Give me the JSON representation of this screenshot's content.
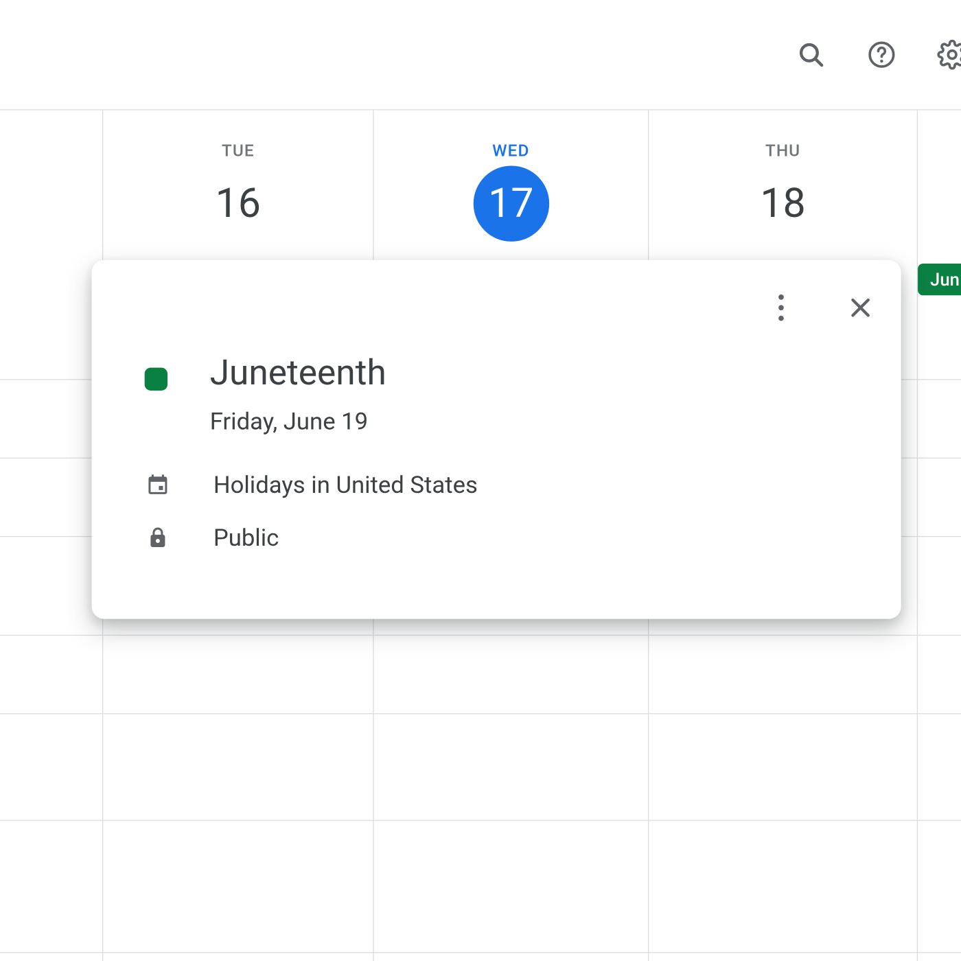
{
  "toolbar": {
    "icons": [
      "search-icon",
      "help-icon",
      "settings-gear-icon"
    ]
  },
  "days": [
    {
      "label": "TUE",
      "num": "16",
      "today": false
    },
    {
      "label": "WED",
      "num": "17",
      "today": true
    },
    {
      "label": "THU",
      "num": "18",
      "today": false
    }
  ],
  "chip": {
    "label": "Jun",
    "color": "#0b8043"
  },
  "event": {
    "color": "#0b8043",
    "title": "Juneteenth",
    "date": "Friday, June 19",
    "calendar": "Holidays in United States",
    "visibility": "Public"
  }
}
